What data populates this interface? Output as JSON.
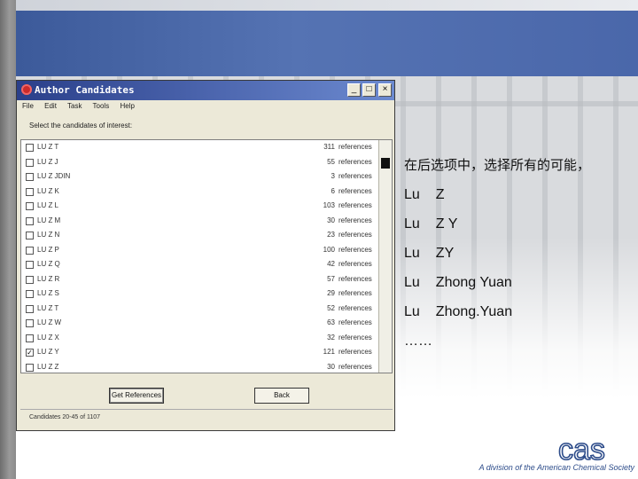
{
  "dialog": {
    "title": "Author Candidates",
    "menu": [
      "File",
      "Edit",
      "Task",
      "Tools",
      "Help"
    ],
    "instruction": "Select the candidates of interest:",
    "items": [
      {
        "name": "LU Z T",
        "count": "311",
        "ref": "references",
        "checked": false
      },
      {
        "name": "LU Z J",
        "count": "55",
        "ref": "references",
        "checked": false
      },
      {
        "name": "LU Z JDIN",
        "count": "3",
        "ref": "references",
        "checked": false
      },
      {
        "name": "LU Z K",
        "count": "6",
        "ref": "references",
        "checked": false
      },
      {
        "name": "LU Z L",
        "count": "103",
        "ref": "references",
        "checked": false
      },
      {
        "name": "LU Z M",
        "count": "30",
        "ref": "references",
        "checked": false
      },
      {
        "name": "LU Z N",
        "count": "23",
        "ref": "references",
        "checked": false
      },
      {
        "name": "LU Z P",
        "count": "100",
        "ref": "references",
        "checked": false
      },
      {
        "name": "LU Z Q",
        "count": "42",
        "ref": "references",
        "checked": false
      },
      {
        "name": "LU Z R",
        "count": "57",
        "ref": "references",
        "checked": false
      },
      {
        "name": "LU Z S",
        "count": "29",
        "ref": "references",
        "checked": false
      },
      {
        "name": "LU Z T",
        "count": "52",
        "ref": "references",
        "checked": false
      },
      {
        "name": "LU Z W",
        "count": "63",
        "ref": "references",
        "checked": false
      },
      {
        "name": "LU Z X",
        "count": "32",
        "ref": "references",
        "checked": false
      },
      {
        "name": "LU Z Y",
        "count": "121",
        "ref": "references",
        "checked": true
      },
      {
        "name": "LU Z Z",
        "count": "30",
        "ref": "references",
        "checked": false
      }
    ],
    "buttons": {
      "get_references": "Get References",
      "back": "Back"
    },
    "status": "Candidates 20-45 of 1107"
  },
  "bullets": [
    {
      "lead": "",
      "text": "在后选项中，选择所有的可能，",
      "cn": true
    },
    {
      "lead": "Lu",
      "text": "Z",
      "cn": false
    },
    {
      "lead": "Lu",
      "text": "Z Y",
      "cn": false
    },
    {
      "lead": "Lu",
      "text": "ZY",
      "cn": false
    },
    {
      "lead": "Lu",
      "text": "Zhong Yuan",
      "cn": false
    },
    {
      "lead": "Lu",
      "text": "Zhong.Yuan",
      "cn": false
    },
    {
      "lead": "",
      "text": "……",
      "cn": false
    }
  ],
  "footer": {
    "logo_text": "cas",
    "tagline": "A division of the American Chemical Society"
  },
  "colors": {
    "header_blue": "#4a67aa",
    "title_blue": "#2a3f8a",
    "footer_blue": "#2d4c8a"
  }
}
